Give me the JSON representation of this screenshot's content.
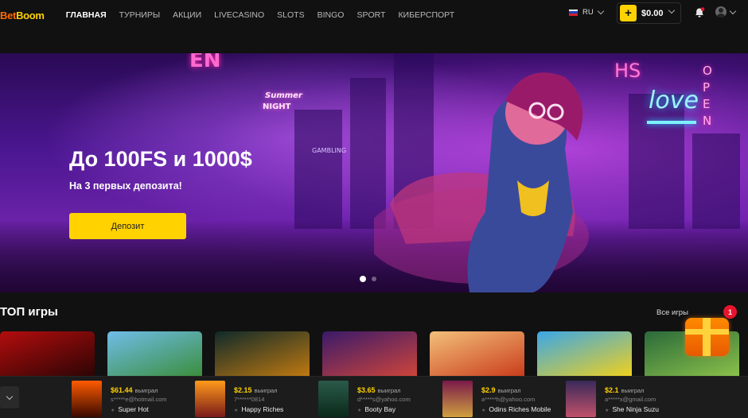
{
  "header": {
    "logo": {
      "part1": "Bet",
      "part2": "Boom"
    },
    "nav": [
      {
        "label": "ГЛАВНАЯ",
        "active": true
      },
      {
        "label": "ТУРНИРЫ"
      },
      {
        "label": "АКЦИИ"
      },
      {
        "label": "LIVECASINO"
      },
      {
        "label": "SLOTS"
      },
      {
        "label": "BINGO"
      },
      {
        "label": "SPORT"
      },
      {
        "label": "КИБЕРСПОРТ"
      }
    ],
    "language": "RU",
    "balance": "$0.00",
    "plus_label": "+"
  },
  "hero": {
    "title": "До 100FS и 1000$",
    "subtitle": "На 3 первых депозита!",
    "button": "Депозит",
    "signs": {
      "open_left": "EN",
      "summer": "Summer",
      "night": "NIGHT",
      "gambling": "GAMBLING",
      "love": "love",
      "open_right": "OPEN",
      "hs": "HS"
    }
  },
  "top_games": {
    "title": "ТОП игры",
    "all_link": "Все игры",
    "games": [
      {
        "name": "game-1",
        "colors": [
          "#b30d0d",
          "#2a0404"
        ]
      },
      {
        "name": "game-2",
        "colors": [
          "#6fbde9",
          "#3a8d3a"
        ]
      },
      {
        "name": "game-3",
        "colors": [
          "#0f2a2a",
          "#c27a10"
        ]
      },
      {
        "name": "game-4",
        "colors": [
          "#3a1a6a",
          "#d0453a"
        ]
      },
      {
        "name": "game-5",
        "colors": [
          "#f3c07a",
          "#c93a1a"
        ]
      },
      {
        "name": "game-6",
        "colors": [
          "#3aa7e8",
          "#f2d11a"
        ]
      },
      {
        "name": "game-7",
        "colors": [
          "#2a6a3a",
          "#8cc24a"
        ]
      }
    ]
  },
  "gift": {
    "badge": "1"
  },
  "wins": [
    {
      "amount": "$61.44",
      "label": "выиграл",
      "user": "s*****e@hotmail.com",
      "game": "Super Hot",
      "colors": [
        "#ff5a00",
        "#3a0a00"
      ]
    },
    {
      "amount": "$2.15",
      "label": "выиграл",
      "user": "7******0814",
      "game": "Happy Riches",
      "colors": [
        "#ff9a1a",
        "#7a1a1a"
      ]
    },
    {
      "amount": "$3.65",
      "label": "выиграл",
      "user": "d*****s@yahoo.com",
      "game": "Booty Bay",
      "colors": [
        "#2a5a4a",
        "#0a2a1a"
      ]
    },
    {
      "amount": "$2.9",
      "label": "выиграл",
      "user": "a*****h@yahoo.com",
      "game": "Odins Riches Mobile",
      "colors": [
        "#7a1a4a",
        "#d0a040"
      ]
    },
    {
      "amount": "$2.1",
      "label": "выиграл",
      "user": "a*****x@gmail.com",
      "game": "She Ninja Suzu",
      "colors": [
        "#3a2a5a",
        "#c0506a"
      ]
    }
  ]
}
